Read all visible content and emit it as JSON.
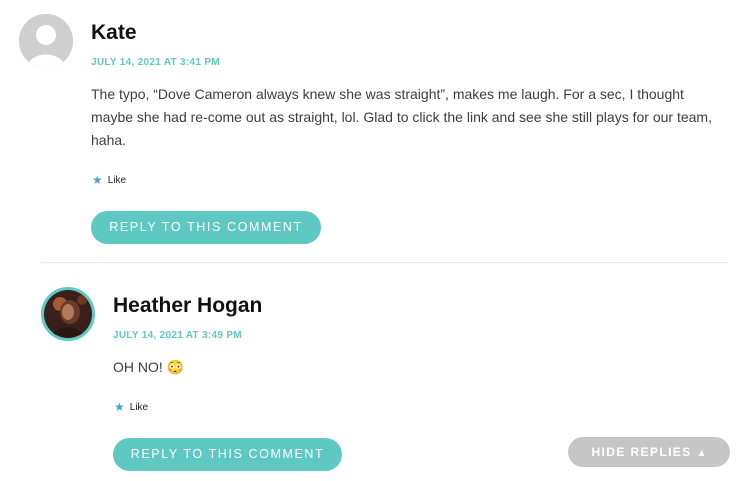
{
  "comments": [
    {
      "author": "Kate",
      "date": "JULY 14, 2021 AT 3:41 PM",
      "text_lines": [
        "The typo, “Dove Cameron always knew she was straight”, makes me laugh. For a sec, I thought",
        "maybe she had re-come out as straight, lol. Glad to click the link and see she still plays for our team,",
        "haha."
      ],
      "like_label": "Like",
      "reply_label": "REPLY TO THIS COMMENT",
      "avatar_icon": "default-user-avatar"
    },
    {
      "author": "Heather Hogan",
      "date": "JULY 14, 2021 AT 3:49 PM",
      "text": "OH NO! 😳",
      "like_label": "Like",
      "reply_label": "REPLY TO THIS COMMENT",
      "avatar_icon": "user-photo-avatar"
    }
  ],
  "hide_replies_label": "HIDE REPLIES",
  "colors": {
    "accent": "#5ec8c2",
    "star": "#4aa3d8",
    "hide_button": "#c6c6c6"
  }
}
